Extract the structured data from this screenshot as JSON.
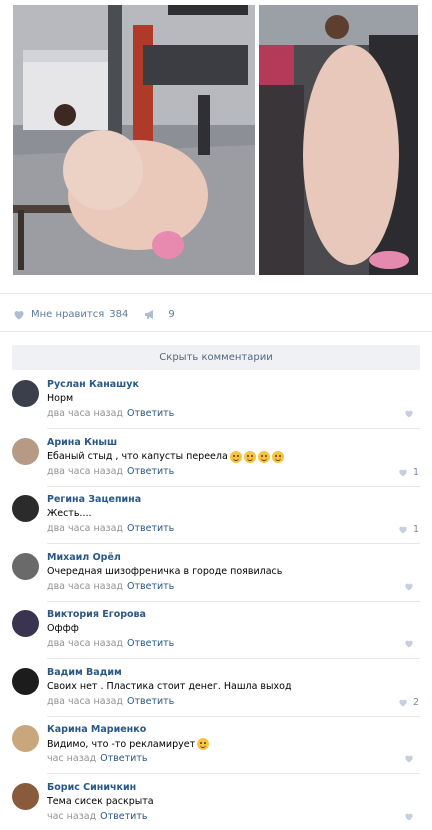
{
  "post": {
    "photos": [
      {
        "name": "photo-platform-woman",
        "description_icon": "photo-icon"
      },
      {
        "name": "photo-tram-woman",
        "description_icon": "photo-icon"
      }
    ],
    "likes": {
      "label": "Мне нравится",
      "count": "384"
    },
    "shares": {
      "count": "9"
    }
  },
  "hide_comments_label": "Скрыть комментарии",
  "reply_label": "Ответить",
  "comments": [
    {
      "name": "Руслан Канашук",
      "text": "Норм",
      "time": "два часа назад",
      "likes": "",
      "avatar_color": "#3a3f4b"
    },
    {
      "name": "Арина Кныш",
      "text": "Ебаный стыд , что капусты переела",
      "emoji_count": 4,
      "time": "два часа назад",
      "likes": "1",
      "avatar_color": "#b79a86"
    },
    {
      "name": "Регина Зацепина",
      "text": "Жесть....",
      "time": "два часа назад",
      "likes": "1",
      "avatar_color": "#2b2b2b"
    },
    {
      "name": "Михаил Орёл",
      "text": "Очередная шизофреничка в городе появилась",
      "time": "два часа назад",
      "likes": "",
      "avatar_color": "#6a6a6a"
    },
    {
      "name": "Виктория Егорова",
      "text": "Оффф",
      "time": "два часа назад",
      "likes": "",
      "avatar_color": "#3b3450"
    },
    {
      "name": "Вадим Вадим",
      "text": "Своих нет . Пластика стоит денег. Нашла выход",
      "time": "два часа назад",
      "likes": "2",
      "avatar_color": "#1c1c1c"
    },
    {
      "name": "Карина Мариенко",
      "text": "Видимо, что -то рекламирует",
      "emoji_count": 1,
      "time": "час назад",
      "likes": "",
      "avatar_color": "#c9a77c"
    },
    {
      "name": "Борис Синичкин",
      "text": "Тема сисек раскрыта",
      "time": "час назад",
      "likes": "",
      "avatar_color": "#8a5a3c"
    }
  ],
  "colors": {
    "link": "#2a5885",
    "meta": "#939393",
    "like": "#5e7b9c",
    "bar": "#eff1f4"
  }
}
